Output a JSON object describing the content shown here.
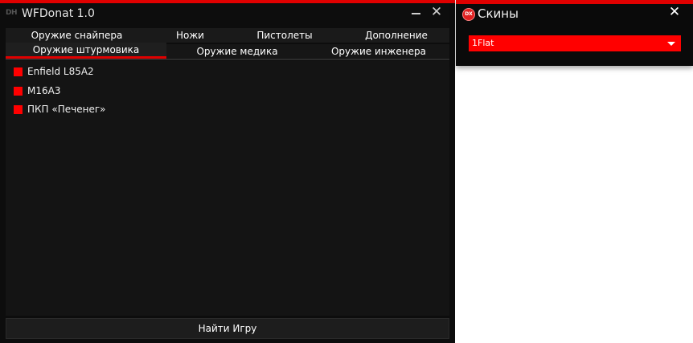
{
  "main_window": {
    "logo": "DH",
    "title": "WFDonat 1.0",
    "close_glyph": "✕",
    "tabs_row1": [
      "Оружие снайпера",
      "Ножи",
      "Пистолеты",
      "Дополнение"
    ],
    "tabs_row2": [
      "Оружие штурмовика",
      "Оружие медика",
      "Оружие инженера"
    ],
    "active_tab": "Оружие штурмовика",
    "items": [
      {
        "label": "Enfield L85A2",
        "checked": true
      },
      {
        "label": "M16A3",
        "checked": true
      },
      {
        "label": "ПКП «Печенег»",
        "checked": true
      }
    ],
    "find_button": "Найти Игру"
  },
  "skins_window": {
    "icon_text": "DX",
    "title": "Скины",
    "close_glyph": "✕",
    "select_value": "1Flat"
  },
  "colors": {
    "accent": "#ff0000",
    "background": "#0d0d0d",
    "panel": "#141414"
  }
}
